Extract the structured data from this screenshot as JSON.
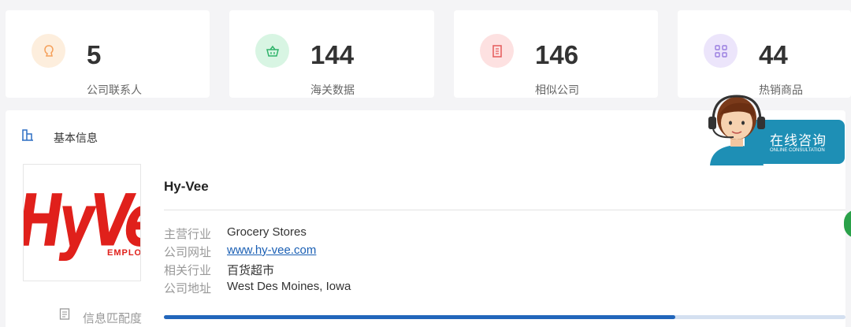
{
  "stats": [
    {
      "value": "5",
      "label": "公司联系人",
      "icon": "contact-icon",
      "color": "#f5a05a",
      "bg": "#fdeedd"
    },
    {
      "value": "144",
      "label": "海关数据",
      "icon": "basket-icon",
      "color": "#2fb36a",
      "bg": "#d8f5e3"
    },
    {
      "value": "146",
      "label": "相似公司",
      "icon": "building-icon",
      "color": "#e55a5a",
      "bg": "#fde1e1"
    },
    {
      "value": "44",
      "label": "热销商品",
      "icon": "grid-icon",
      "color": "#9a7ee0",
      "bg": "#ece5fb"
    }
  ],
  "section": {
    "title": "基本信息",
    "icon": "building-chart-icon"
  },
  "company": {
    "name": "Hy-Vee",
    "logo_text": "HyVe",
    "logo_sub": "EMPLO",
    "industry_label": "主营行业",
    "industry": "Grocery Stores",
    "website_label": "公司网址",
    "website": "www.hy-vee.com",
    "related_label": "相关行业",
    "related": "百货超市",
    "address_label": "公司地址",
    "address": "West Des Moines, Iowa"
  },
  "match": {
    "label": "信息匹配度",
    "percent": 75
  },
  "consult": {
    "main": "在线咨询",
    "sub": "ONLINE CONSULTATION"
  },
  "colors": {
    "accent": "#2266bb",
    "consult": "#1e8fb5",
    "logo_red": "#e0201b"
  }
}
